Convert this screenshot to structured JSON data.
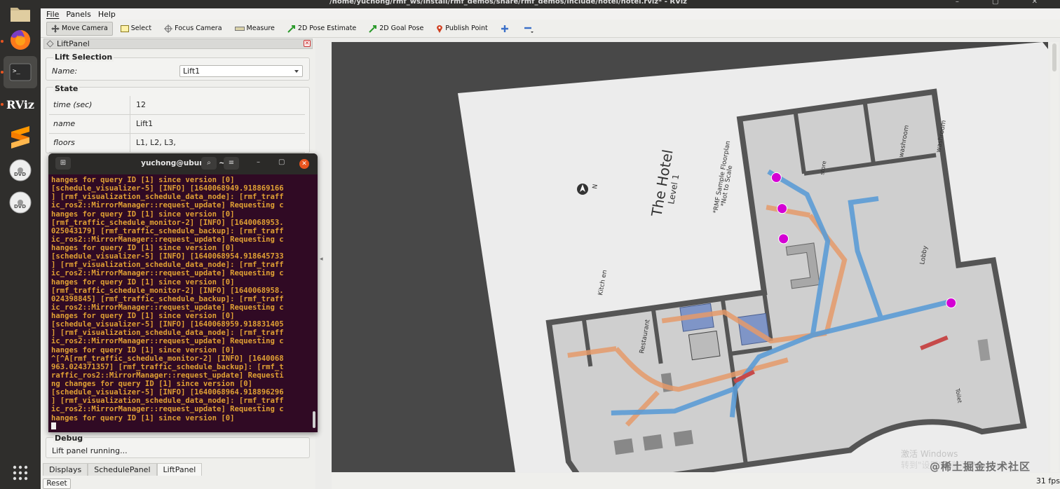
{
  "window": {
    "title": "/home/yuchong/rmf_ws/install/rmf_demos/share/rmf_demos/include/hotel/hotel.rviz* - RViz",
    "controls": "–  ▢  ✕"
  },
  "dock": {
    "items": [
      "files-icon",
      "firefox-icon",
      "terminal-icon",
      "rviz-icon",
      "sublime-icon",
      "dvd-icon",
      "dvd-icon",
      "apps-grid-icon"
    ],
    "rviz_label": "RViz",
    "dvd_label": "DVD"
  },
  "menu": {
    "file": "File",
    "panels": "Panels",
    "help": "Help"
  },
  "toolbar": {
    "move_camera": "Move Camera",
    "select": "Select",
    "focus_camera": "Focus Camera",
    "measure": "Measure",
    "pose_estimate": "2D Pose Estimate",
    "goal_pose": "2D Goal Pose",
    "publish_point": "Publish Point"
  },
  "lift_panel": {
    "title": "LiftPanel",
    "selection_title": "Lift Selection",
    "name_label": "Name:",
    "name_value": "Lift1",
    "state_title": "State",
    "state_rows": [
      {
        "key": "time (sec)",
        "value": "12"
      },
      {
        "key": "name",
        "value": "Lift1"
      },
      {
        "key": "floors",
        "value": "L1, L2, L3,"
      }
    ],
    "debug_title": "Debug",
    "debug_text": "Lift panel running..."
  },
  "tabs": [
    "Displays",
    "SchedulePanel",
    "LiftPanel"
  ],
  "reset_label": "Reset",
  "terminal": {
    "title": "yuchong@ubuntu: ~",
    "lines": [
      "hanges for query ID [1] since version [0]",
      "[schedule_visualizer-5] [INFO] [1640068949.918869166",
      "] [rmf_visualization_schedule_data_node]: [rmf_traff",
      "ic_ros2::MirrorManager::request_update] Requesting c",
      "hanges for query ID [1] since version [0]",
      "[rmf_traffic_schedule_monitor-2] [INFO] [1640068953.",
      "025043179] [rmf_traffic_schedule_backup]: [rmf_traff",
      "ic_ros2::MirrorManager::request_update] Requesting c",
      "hanges for query ID [1] since version [0]",
      "[schedule_visualizer-5] [INFO] [1640068954.918645733",
      "] [rmf_visualization_schedule_data_node]: [rmf_traff",
      "ic_ros2::MirrorManager::request_update] Requesting c",
      "hanges for query ID [1] since version [0]",
      "[rmf_traffic_schedule_monitor-2] [INFO] [1640068958.",
      "024398845] [rmf_traffic_schedule_backup]: [rmf_traff",
      "ic_ros2::MirrorManager::request_update] Requesting c",
      "hanges for query ID [1] since version [0]",
      "[schedule_visualizer-5] [INFO] [1640068959.918831405",
      "] [rmf_visualization_schedule_data_node]: [rmf_traff",
      "ic_ros2::MirrorManager::request_update] Requesting c",
      "hanges for query ID [1] since version [0]",
      "^[^A[rmf_traffic_schedule_monitor-2] [INFO] [1640068",
      "963.024371357] [rmf_traffic_schedule_backup]: [rmf_t",
      "raffic_ros2::MirrorManager::request_update] Requesti",
      "ng changes for query ID [1] since version [0]",
      "[schedule_visualizer-5] [INFO] [1640068964.918896296",
      "] [rmf_visualization_schedule_data_node]: [rmf_traff",
      "ic_ros2::MirrorManager::request_update] Requesting c",
      "hanges for query ID [1] since version [0]"
    ]
  },
  "map": {
    "hotel_title": "The Hotel",
    "level": "Level 1",
    "floorplan_note_1": "*RMF Sample Floorplan",
    "floorplan_note_2": "*Not to Scale",
    "north": "N",
    "rooms": {
      "kitchen": "Kitch en",
      "restaurant": "Restaurant",
      "lobby": "Lobby",
      "washroom_1": "washroom",
      "washroom_2": "washroom",
      "store": "store",
      "toilet": "Toilet"
    },
    "colors": {
      "blue_path": "#5b9bd5",
      "orange_path": "#e59a6a",
      "robot": "#d400d4",
      "wall": "#5a5a5a",
      "floor": "#c8c8c8"
    }
  },
  "status": {
    "fps": "31 fps"
  },
  "watermark": {
    "line1": "激活 Windows",
    "line2": "转到\"设置\"以激活 Windows。",
    "site": "@稀土掘金技术社区"
  }
}
